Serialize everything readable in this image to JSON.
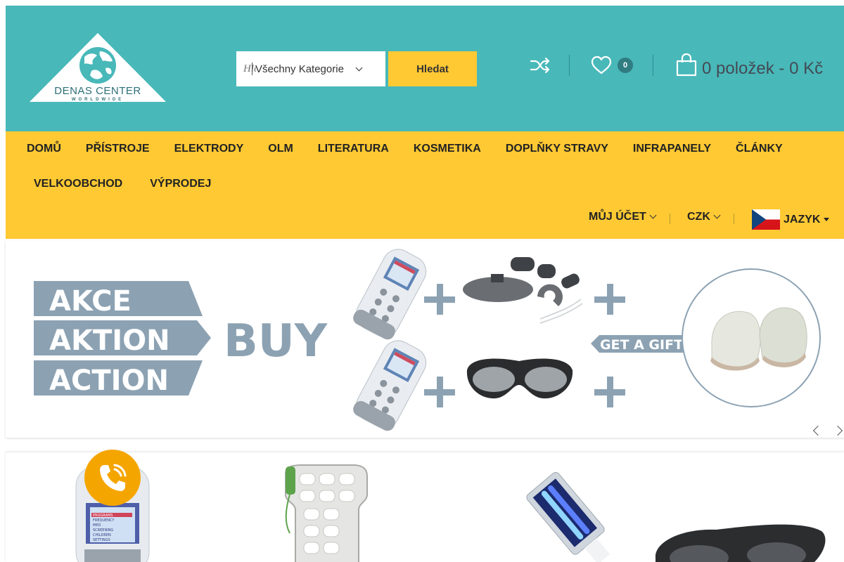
{
  "header": {
    "logo": {
      "brand": "DENAS CENTER",
      "tagline": "WORLDWIDE"
    },
    "search": {
      "placeholder": "Hledat",
      "category_label": "Všechny Kategorie",
      "button_label": "Hledat"
    },
    "wishlist_count": "0",
    "cart_text": "0 položek - 0 Kč"
  },
  "nav": {
    "items": [
      "DOMŮ",
      "PŘÍSTROJE",
      "ELEKTRODY",
      "OLM",
      "LITERATURA",
      "KOSMETIKA",
      "DOPLŇKY STRAVY",
      "INFRAPANELY",
      "ČLÁNKY"
    ],
    "items_row2": [
      "VELKOOBCHOD",
      "VÝPRODEJ"
    ],
    "account_label": "MŮJ ÚČET",
    "currency_label": "CZK",
    "language_label": "JAZYK"
  },
  "hero": {
    "labels": [
      "AKCE",
      "AKTION",
      "ACTION"
    ],
    "buy_text": "BUY",
    "gift_text": "GET A GIFT",
    "device_screen_lines": [
      "PROGRAMS",
      "FREQUENCY",
      "MED",
      "SCREENING",
      "CHILDREN",
      "SETTINGS"
    ]
  },
  "colors": {
    "header_bg": "#48b8b9",
    "nav_bg": "#ffc933",
    "phone_button": "#f5a500",
    "banner_label": "#8ca2b3"
  },
  "icons": [
    "shuffle-icon",
    "heart-icon",
    "shopping-bag-icon",
    "czech-flag-icon",
    "phone-icon",
    "chevron-left-icon",
    "chevron-right-icon"
  ]
}
